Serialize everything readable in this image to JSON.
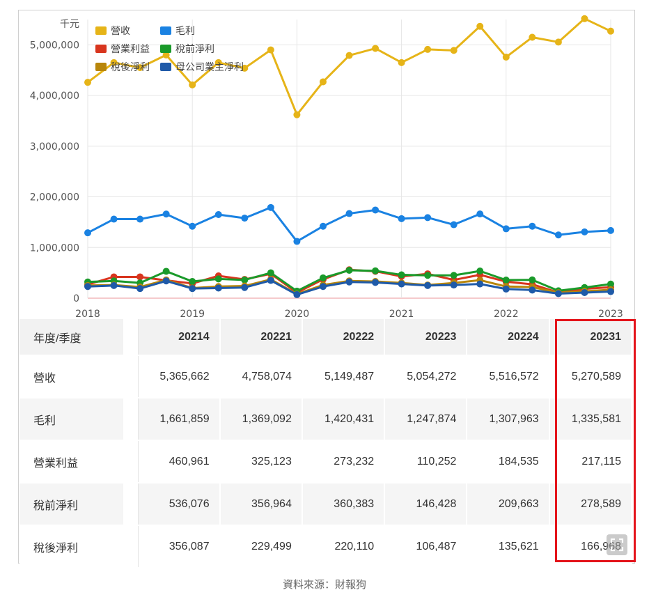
{
  "chart_data": {
    "type": "line",
    "ylabel": "千元",
    "ylim": [
      0,
      5500000
    ],
    "yticks": [
      "0",
      "1,000,000",
      "2,000,000",
      "3,000,000",
      "4,000,000",
      "5,000,000"
    ],
    "ytick_values": [
      0,
      1000000,
      2000000,
      3000000,
      4000000,
      5000000
    ],
    "xticks": [
      "2018",
      "2019",
      "2020",
      "2021",
      "2022",
      "2023"
    ],
    "xtick_values": [
      2018,
      2019,
      2020,
      2021,
      2022,
      2023
    ],
    "x": [
      2018.0,
      2018.25,
      2018.5,
      2018.75,
      2019.0,
      2019.25,
      2019.5,
      2019.75,
      2020.0,
      2020.25,
      2020.5,
      2020.75,
      2021.0,
      2021.25,
      2021.5,
      2021.75,
      2022.0,
      2022.25,
      2022.5,
      2022.75,
      2023.0
    ],
    "grid": true,
    "legend_position": "top-left",
    "series": [
      {
        "name": "營收",
        "color": "#e6b418",
        "values": [
          4260000,
          4650000,
          4550000,
          4800000,
          4210000,
          4650000,
          4540000,
          4900000,
          3620000,
          4270000,
          4790000,
          4930000,
          4650000,
          4910000,
          4890000,
          5365662,
          4758074,
          5149487,
          5054272,
          5516572,
          5270589
        ]
      },
      {
        "name": "毛利",
        "color": "#1a82e2",
        "values": [
          1290000,
          1560000,
          1560000,
          1660000,
          1420000,
          1650000,
          1580000,
          1790000,
          1120000,
          1420000,
          1670000,
          1740000,
          1570000,
          1590000,
          1450000,
          1661859,
          1369092,
          1420431,
          1247874,
          1307963,
          1335581
        ]
      },
      {
        "name": "營業利益",
        "color": "#d8351e",
        "values": [
          270000,
          420000,
          420000,
          350000,
          290000,
          440000,
          370000,
          480000,
          110000,
          370000,
          560000,
          530000,
          430000,
          480000,
          360000,
          460961,
          325123,
          273232,
          110252,
          184535,
          217115
        ]
      },
      {
        "name": "稅前淨利",
        "color": "#1a9a2a",
        "values": [
          320000,
          340000,
          300000,
          530000,
          330000,
          380000,
          360000,
          500000,
          140000,
          400000,
          550000,
          540000,
          460000,
          450000,
          450000,
          536076,
          356964,
          360383,
          146428,
          209663,
          278589
        ]
      },
      {
        "name": "稅後淨利",
        "color": "#b8860b",
        "values": [
          250000,
          260000,
          220000,
          360000,
          200000,
          230000,
          240000,
          370000,
          80000,
          260000,
          340000,
          330000,
          300000,
          260000,
          300000,
          356087,
          229499,
          220110,
          106487,
          135621,
          166968
        ]
      },
      {
        "name": "母公司業主淨利",
        "color": "#1f5aa8",
        "values": [
          230000,
          250000,
          190000,
          340000,
          190000,
          200000,
          210000,
          350000,
          70000,
          230000,
          320000,
          310000,
          280000,
          250000,
          260000,
          280000,
          180000,
          160000,
          90000,
          110000,
          130000
        ]
      }
    ]
  },
  "table": {
    "header_label": "年度/季度",
    "periods": [
      "20214",
      "20221",
      "20222",
      "20223",
      "20224",
      "20231"
    ],
    "rows": [
      {
        "label": "營收",
        "values": [
          "5,365,662",
          "4,758,074",
          "5,149,487",
          "5,054,272",
          "5,516,572",
          "5,270,589"
        ]
      },
      {
        "label": "毛利",
        "values": [
          "1,661,859",
          "1,369,092",
          "1,420,431",
          "1,247,874",
          "1,307,963",
          "1,335,581"
        ]
      },
      {
        "label": "營業利益",
        "values": [
          "460,961",
          "325,123",
          "273,232",
          "110,252",
          "184,535",
          "217,115"
        ]
      },
      {
        "label": "稅前淨利",
        "values": [
          "536,076",
          "356,964",
          "360,383",
          "146,428",
          "209,663",
          "278,589"
        ]
      },
      {
        "label": "稅後淨利",
        "values": [
          "356,087",
          "229,499",
          "220,110",
          "106,487",
          "135,621",
          "166,968"
        ]
      }
    ]
  },
  "highlight_color": "#e4141b",
  "expand_icon": "expand-icon",
  "source": "資料來源：財報狗"
}
